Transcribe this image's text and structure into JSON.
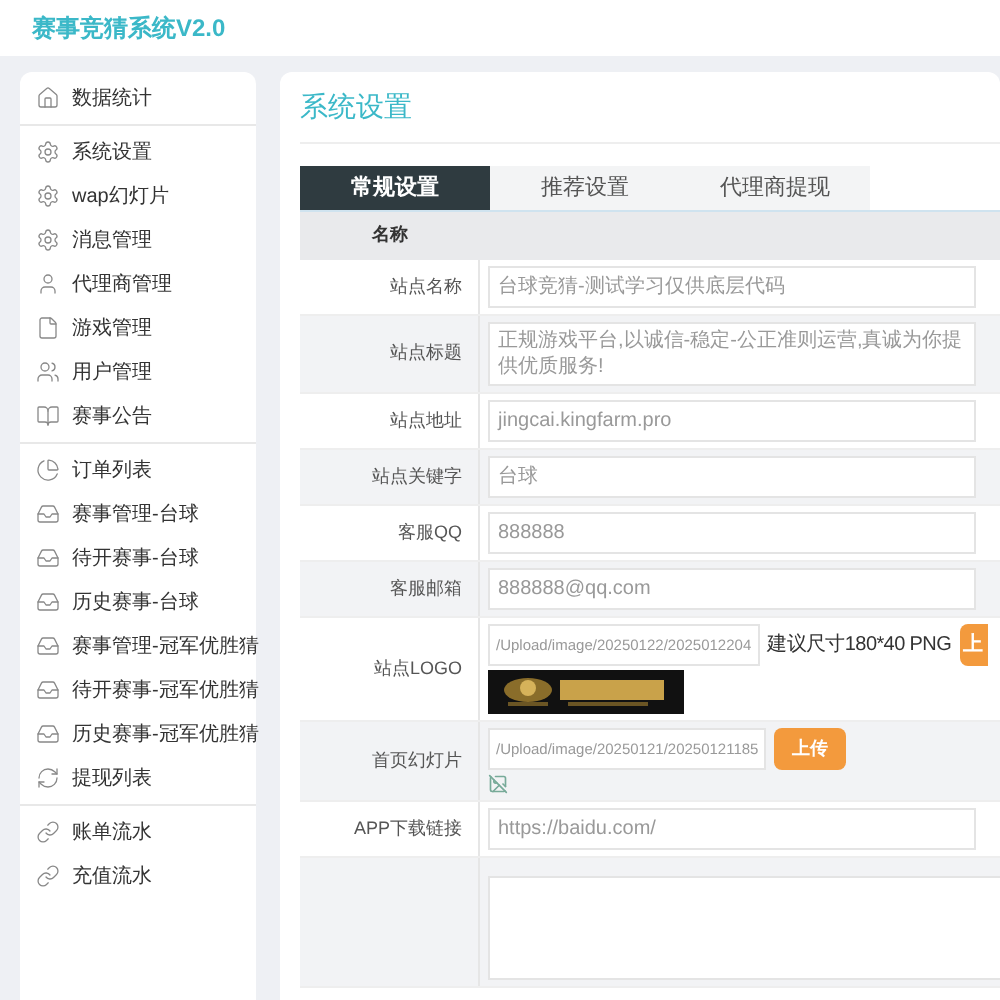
{
  "app_title": "赛事竞猜系统V2.0",
  "sidebar": {
    "groups": [
      {
        "items": [
          {
            "label": "数据统计",
            "selected": false
          }
        ]
      },
      {
        "items": [
          {
            "label": "系统设置",
            "selected": false
          },
          {
            "label": "wap幻灯片",
            "selected": false
          },
          {
            "label": "消息管理",
            "selected": false
          },
          {
            "label": "代理商管理",
            "selected": false
          },
          {
            "label": "游戏管理",
            "selected": false
          },
          {
            "label": "用户管理",
            "selected": false
          },
          {
            "label": "赛事公告",
            "selected": false
          }
        ]
      },
      {
        "items": [
          {
            "label": "订单列表",
            "selected": false
          },
          {
            "label": "赛事管理-台球",
            "selected": false
          },
          {
            "label": "待开赛事-台球",
            "selected": false
          },
          {
            "label": "历史赛事-台球",
            "selected": false
          },
          {
            "label": "赛事管理-冠军优胜猜",
            "selected": false
          },
          {
            "label": "待开赛事-冠军优胜猜",
            "selected": false
          },
          {
            "label": "历史赛事-冠军优胜猜",
            "selected": false
          },
          {
            "label": "提现列表",
            "selected": false
          }
        ]
      },
      {
        "items": [
          {
            "label": "账单流水",
            "selected": false
          },
          {
            "label": "充值流水",
            "selected": false
          }
        ]
      }
    ]
  },
  "page_title": "系统设置",
  "tabs": [
    {
      "label": "常规设置",
      "selected": true
    },
    {
      "label": "推荐设置",
      "selected": false
    },
    {
      "label": "代理商提现",
      "selected": false
    }
  ],
  "table": {
    "header": "名称",
    "rows": [
      {
        "kind": "text",
        "label": "站点名称",
        "value": "台球竞猜-测试学习仅供底层代码"
      },
      {
        "kind": "text",
        "label": "站点标题",
        "value": "正规游戏平台,以诚信-稳定-公正准则运营,真诚为你提供优质服务!"
      },
      {
        "kind": "text",
        "label": "站点地址",
        "value": "jingcai.kingfarm.pro"
      },
      {
        "kind": "text",
        "label": "站点关键字",
        "value": "台球"
      },
      {
        "kind": "text",
        "label": "客服QQ",
        "value": "888888"
      },
      {
        "kind": "text",
        "label": "客服邮箱",
        "value": "888888@qq.com"
      },
      {
        "kind": "logo",
        "label": "站点LOGO",
        "value": "/Upload/image/20250122/2025012204",
        "hint": "建议尺寸180*40 PNG",
        "button": "上"
      },
      {
        "kind": "broken",
        "label": "首页幻灯片",
        "value": "/Upload/image/20250121/20250121185",
        "button": "上传"
      },
      {
        "kind": "text",
        "label": "APP下载链接",
        "value": "https://baidu.com/"
      },
      {
        "kind": "textarea"
      }
    ]
  }
}
